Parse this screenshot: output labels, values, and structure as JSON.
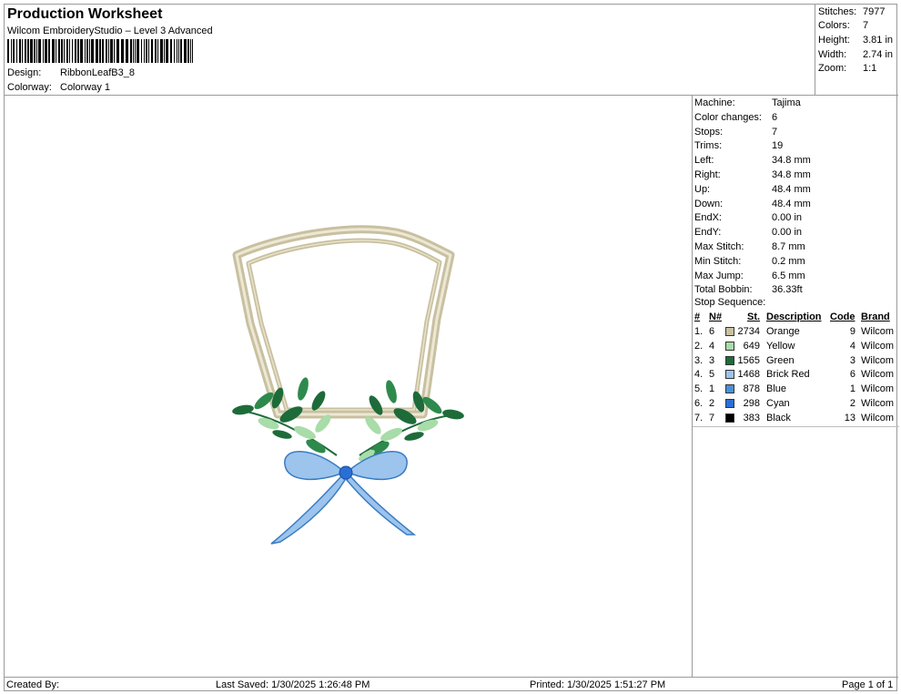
{
  "header": {
    "title": "Production Worksheet",
    "subtitle": "Wilcom EmbroideryStudio – Level 3 Advanced",
    "design_label": "Design:",
    "design_value": "RibbonLeafB3_8",
    "colorway_label": "Colorway:",
    "colorway_value": "Colorway 1"
  },
  "stats": [
    {
      "label": "Stitches:",
      "value": "7977"
    },
    {
      "label": "Colors:",
      "value": "7"
    },
    {
      "label": "Height:",
      "value": "3.81 in"
    },
    {
      "label": "Width:",
      "value": "2.74 in"
    },
    {
      "label": "Zoom:",
      "value": "1:1"
    }
  ],
  "properties": [
    {
      "label": "Machine:",
      "value": "Tajima"
    },
    {
      "label": "Color changes:",
      "value": "6"
    },
    {
      "label": "Stops:",
      "value": "7"
    },
    {
      "label": "Trims:",
      "value": "19"
    },
    {
      "label": "Left:",
      "value": "34.8 mm"
    },
    {
      "label": "Right:",
      "value": "34.8 mm"
    },
    {
      "label": "Up:",
      "value": "48.4 mm"
    },
    {
      "label": "Down:",
      "value": "48.4 mm"
    },
    {
      "label": "EndX:",
      "value": "0.00 in"
    },
    {
      "label": "EndY:",
      "value": "0.00 in"
    },
    {
      "label": "Max Stitch:",
      "value": "8.7 mm"
    },
    {
      "label": "Min Stitch:",
      "value": "0.2 mm"
    },
    {
      "label": "Max Jump:",
      "value": "6.5 mm"
    },
    {
      "label": "Total Bobbin:",
      "value": "36.33ft"
    }
  ],
  "stop_sequence": {
    "title": "Stop Sequence:",
    "headers": {
      "num": "#",
      "n": "N#",
      "st": "St.",
      "desc": "Description",
      "code": "Code",
      "brand": "Brand"
    },
    "rows": [
      {
        "num": "1.",
        "n": "6",
        "color": "#c8c0a0",
        "st": "2734",
        "desc": "Orange",
        "code": "9",
        "brand": "Wilcom"
      },
      {
        "num": "2.",
        "n": "4",
        "color": "#a8dca8",
        "st": "649",
        "desc": "Yellow",
        "code": "4",
        "brand": "Wilcom"
      },
      {
        "num": "3.",
        "n": "3",
        "color": "#1e6b3a",
        "st": "1565",
        "desc": "Green",
        "code": "3",
        "brand": "Wilcom"
      },
      {
        "num": "4.",
        "n": "5",
        "color": "#9cc4ec",
        "st": "1468",
        "desc": "Brick Red",
        "code": "6",
        "brand": "Wilcom"
      },
      {
        "num": "5.",
        "n": "1",
        "color": "#4a90d9",
        "st": "878",
        "desc": "Blue",
        "code": "1",
        "brand": "Wilcom"
      },
      {
        "num": "6.",
        "n": "2",
        "color": "#2a6fd6",
        "st": "298",
        "desc": "Cyan",
        "code": "2",
        "brand": "Wilcom"
      },
      {
        "num": "7.",
        "n": "7",
        "color": "#000000",
        "st": "383",
        "desc": "Black",
        "code": "13",
        "brand": "Wilcom"
      }
    ]
  },
  "footer": {
    "created_by": "Created By:",
    "last_saved": "Last Saved: 1/30/2025 1:26:48 PM",
    "printed": "Printed: 1/30/2025 1:51:27 PM",
    "page": "Page 1 of 1"
  },
  "design_colors": {
    "frame_outer": "#c8c0a0",
    "frame_inner": "#e4dec4",
    "leaf_light": "#a8dca8",
    "leaf_dark": "#1e6b3a",
    "ribbon_light": "#9cc4ec",
    "ribbon_mid": "#4a90d9",
    "ribbon_knot": "#2a6fd6"
  }
}
